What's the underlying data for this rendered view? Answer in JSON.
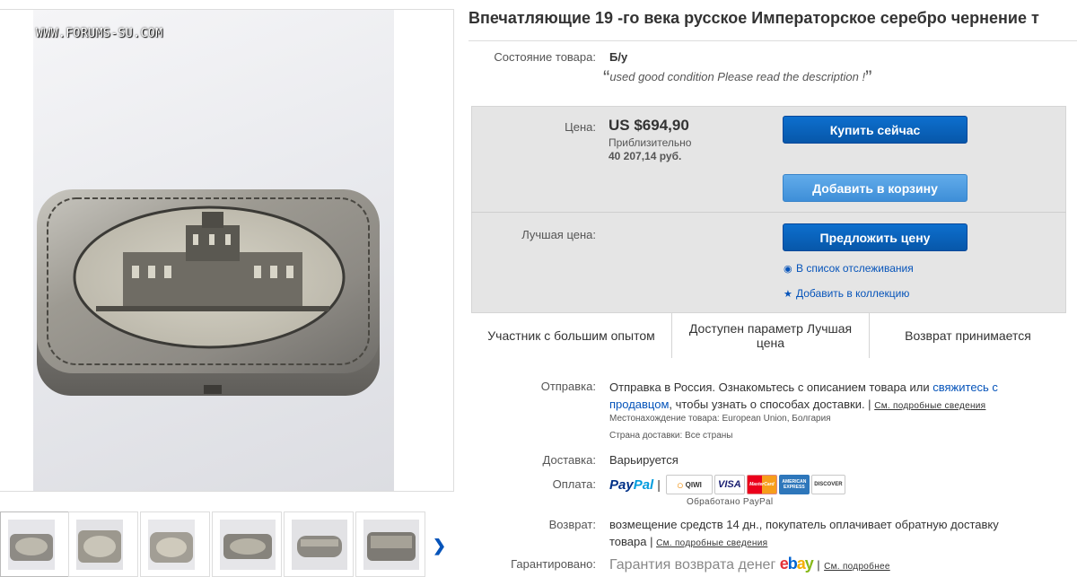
{
  "watermark": "WWW.FORUMS-SU.COM",
  "title": "Впечатляющие 19 -го века русское Императорское серебро чернение т",
  "condition": {
    "label": "Состояние товара:",
    "value": "Б/у",
    "description": "used good condition Please read the description !"
  },
  "buybox": {
    "price_label": "Цена:",
    "price": "US $694,90",
    "approx_label": "Приблизительно",
    "approx_value": "40 207,14 руб.",
    "buy_now": "Купить сейчас",
    "add_to_cart": "Добавить в корзину",
    "best_offer_label": "Лучшая цена:",
    "make_offer": "Предложить цену",
    "watchlist": "В список отслеживания",
    "add_collection": "Добавить в коллекцию"
  },
  "badges": [
    "Участник с большим опытом",
    "Доступен параметр Лучшая цена",
    "Возврат принимается"
  ],
  "shipping": {
    "label": "Отправка:",
    "text1": "Отправка в Россия. Ознакомьтесь с описанием товара или ",
    "contact_link_1": "свяжитесь с",
    "contact_link_2": "продавцом",
    "text2": ", чтобы узнать о способах доставки. |",
    "details_link": "См. подробные сведения",
    "location": "Местонахождение товара:  European Union, Болгария",
    "ships_to": "Страна доставки:  Все страны"
  },
  "delivery": {
    "label": "Доставка:",
    "value": "Варьируется"
  },
  "payment": {
    "label": "Оплата:",
    "paypal_pay": "Pay",
    "paypal_pal": "Pal",
    "separator": "|",
    "cards": [
      "QIWI",
      "VISA",
      "MasterCard",
      "AMERICAN EXPRESS",
      "DISCOVER"
    ],
    "processed": "Обработано PayPal"
  },
  "returns": {
    "label": "Возврат:",
    "text1": "возмещение средств 14 дн., покупатель оплачивает обратную доставку",
    "text2": "товара |",
    "details_link": "См. подробные сведения"
  },
  "guarantee": {
    "label": "Гарантировано:",
    "text": "Гарантия возврата денег",
    "details_link": "См. подробнее"
  },
  "colors": {
    "primary_button": "#0757a9",
    "secondary_button": "#3e8fd8",
    "link": "#0654ba",
    "buybox_bg": "#e5e5e5"
  }
}
